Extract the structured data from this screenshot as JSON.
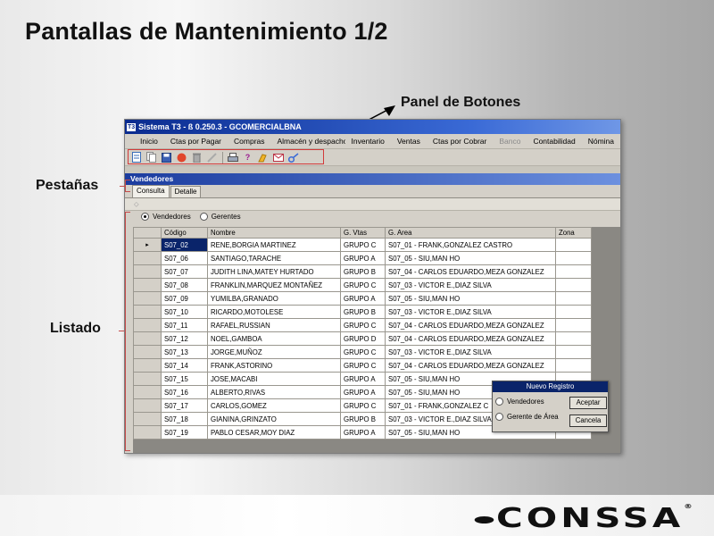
{
  "slide": {
    "title": "Pantallas de Mantenimiento 1/2",
    "callouts": {
      "panel_botones": "Panel de Botones",
      "pestanas": "Pestañas",
      "listado": "Listado"
    },
    "logo_text": "CONSSA",
    "logo_mark": "®"
  },
  "app": {
    "window_title": "Sistema T3 - ß 0.250.3 - GCOMERCIALBNA",
    "logo_badge": "T3",
    "menu": [
      "Inicio",
      "Ctas por Pagar",
      "Compras",
      "Almacén y despacho",
      "Inventario",
      "Ventas",
      "Ctas por Cobrar",
      "Banco",
      "Contabilidad",
      "Nómina"
    ],
    "disabled_menu": "Banco",
    "toolbar_icons": [
      "new-icon",
      "copy-icon",
      "save-icon",
      "delete-record-icon",
      "trash-icon",
      "edit-icon",
      "print-icon",
      "help-icon",
      "broom-icon",
      "mail-icon",
      "key-icon"
    ],
    "subwindow_title": "Vendedores",
    "tabs": [
      "Consulta",
      "Detalle"
    ],
    "radio": {
      "vendedores": "Vendedores",
      "gerentes": "Gerentes",
      "selected": "Vendedores"
    },
    "grid": {
      "columns": [
        "Código",
        "Nombre",
        "G. Vtas",
        "G. Area",
        "Zona"
      ],
      "rows": [
        [
          "S07_02",
          "RENE,BORGIA MARTINEZ",
          "GRUPO C",
          "S07_01 - FRANK,GONZALEZ CASTRO",
          ""
        ],
        [
          "S07_06",
          "SANTIAGO,TARACHE",
          "GRUPO A",
          "S07_05 - SIU,MAN HO",
          ""
        ],
        [
          "S07_07",
          "JUDITH LINA,MATEY HURTADO",
          "GRUPO B",
          "S07_04 - CARLOS EDUARDO,MEZA GONZALEZ",
          ""
        ],
        [
          "S07_08",
          "FRANKLIN,MARQUEZ MONTAÑEZ",
          "GRUPO C",
          "S07_03 - VICTOR E.,DIAZ SILVA",
          ""
        ],
        [
          "S07_09",
          "YUMILBA,GRANADO",
          "GRUPO A",
          "S07_05 - SIU,MAN HO",
          ""
        ],
        [
          "S07_10",
          "RICARDO,MOTOLESE",
          "GRUPO B",
          "S07_03 - VICTOR E.,DIAZ SILVA",
          ""
        ],
        [
          "S07_11",
          "RAFAEL,RUSSIAN",
          "GRUPO C",
          "S07_04 - CARLOS EDUARDO,MEZA GONZALEZ",
          ""
        ],
        [
          "S07_12",
          "NOEL,GAMBOA",
          "GRUPO D",
          "S07_04 - CARLOS EDUARDO,MEZA GONZALEZ",
          ""
        ],
        [
          "S07_13",
          "JORGE,MUÑOZ",
          "GRUPO C",
          "S07_03 - VICTOR E.,DIAZ SILVA",
          ""
        ],
        [
          "S07_14",
          "FRANK,ASTORINO",
          "GRUPO C",
          "S07_04 - CARLOS EDUARDO,MEZA GONZALEZ",
          ""
        ],
        [
          "S07_15",
          "JOSE,MACABI",
          "GRUPO A",
          "S07_05 - SIU,MAN HO",
          ""
        ],
        [
          "S07_16",
          "ALBERTO,RIVAS",
          "GRUPO A",
          "S07_05 - SIU,MAN HO",
          ""
        ],
        [
          "S07_17",
          "CARLOS,GOMEZ",
          "GRUPO C",
          "S07_01 - FRANK,GONZALEZ C",
          ""
        ],
        [
          "S07_18",
          "GIANINA,GRINZATO",
          "GRUPO B",
          "S07_03 - VICTOR E.,DIAZ SILVA",
          ""
        ],
        [
          "S07_19",
          "PABLO CESAR,MOY DIAZ",
          "GRUPO A",
          "S07_05 - SIU,MAN HO",
          ""
        ]
      ],
      "selected_row": 0,
      "row_pointer": "▸"
    },
    "dialog": {
      "title": "Nuevo Registro",
      "option_1": "Vendedores",
      "option_2": "Gerente de Área",
      "accept": "Aceptar",
      "cancel": "Cancela"
    }
  },
  "colors": {
    "titlebar": "#0a246a",
    "highlight_box": "#d23a3a",
    "selection": "#0a246a"
  }
}
